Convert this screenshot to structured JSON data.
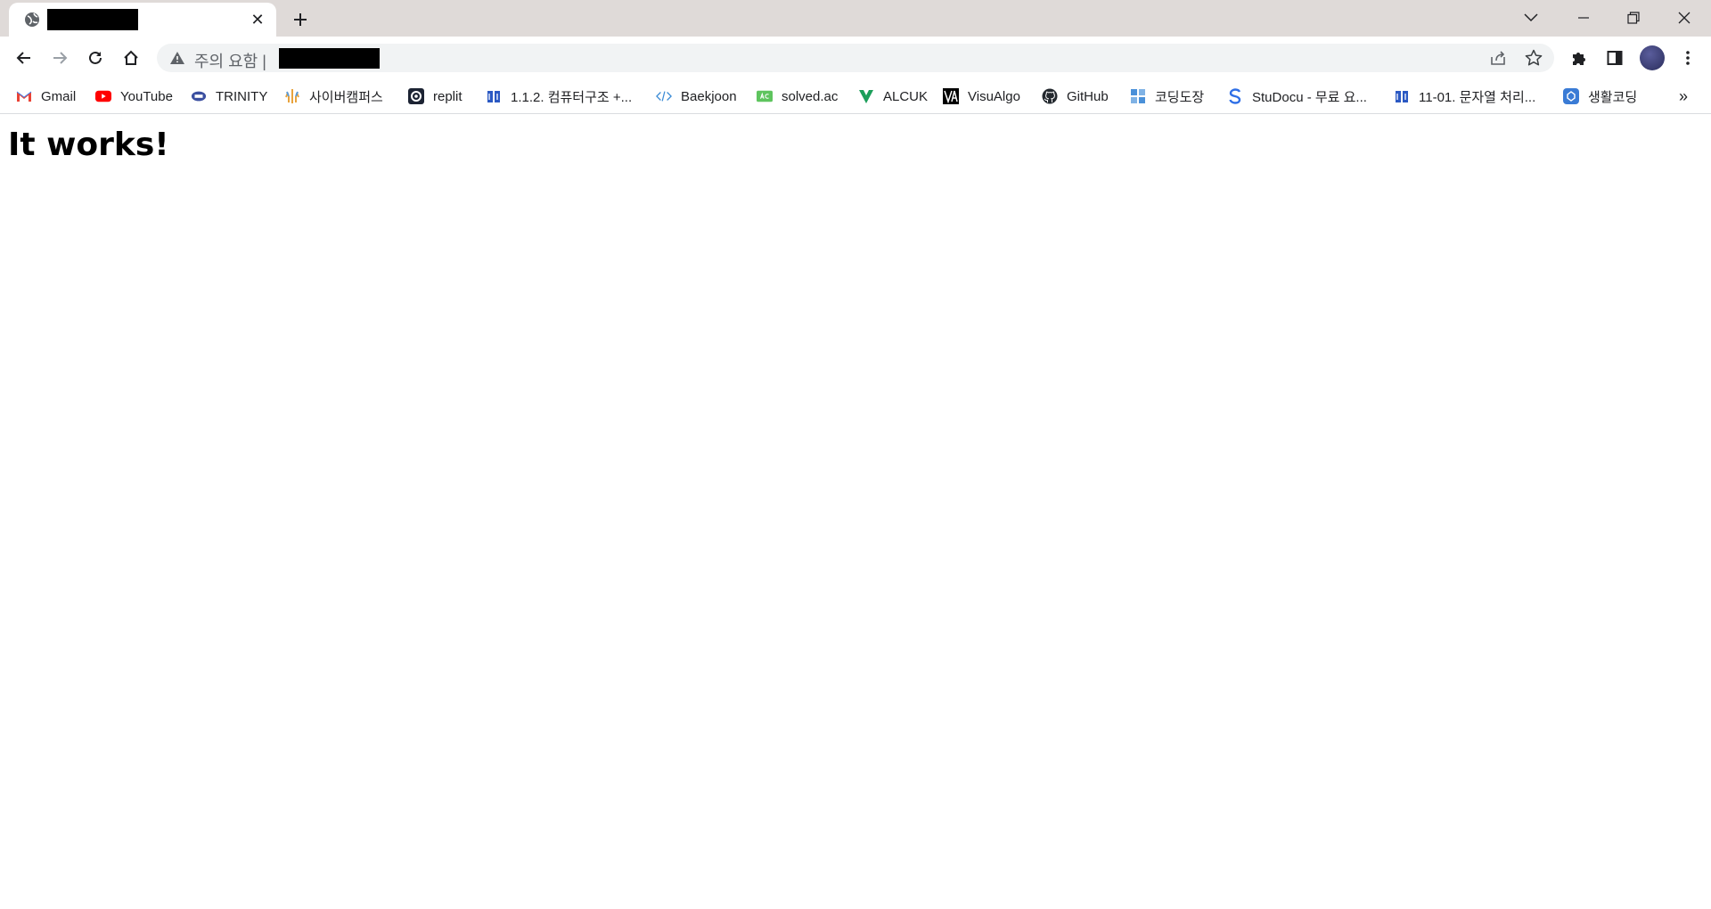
{
  "tab": {
    "close_glyph": "✕",
    "new_tab_glyph": "+"
  },
  "omnibox": {
    "security_label": "주의 요함 |"
  },
  "bookmarks": [
    {
      "label": "Gmail",
      "icon": "gmail-icon"
    },
    {
      "label": "YouTube",
      "icon": "youtube-icon"
    },
    {
      "label": "TRINITY",
      "icon": "trinity-icon"
    },
    {
      "label": "사이버캠퍼스",
      "icon": "cybercampus-icon"
    },
    {
      "label": "replit",
      "icon": "replit-icon"
    },
    {
      "label": "1.1.2. 컴퓨터구조 +...",
      "icon": "book-icon"
    },
    {
      "label": "Baekjoon",
      "icon": "code-icon"
    },
    {
      "label": "solved.ac",
      "icon": "solvedac-icon"
    },
    {
      "label": "ALCUK",
      "icon": "alcuk-icon"
    },
    {
      "label": "VisuAlgo",
      "icon": "visualgo-icon"
    },
    {
      "label": "GitHub",
      "icon": "github-icon"
    },
    {
      "label": "코딩도장",
      "icon": "codingdojang-icon"
    },
    {
      "label": "StuDocu - 무료 요...",
      "icon": "studocu-icon"
    },
    {
      "label": "11-01. 문자열 처리...",
      "icon": "book-icon"
    },
    {
      "label": "생활코딩",
      "icon": "opentutorials-icon"
    }
  ],
  "bookmarks_more": "»",
  "page": {
    "heading": "It works!"
  }
}
